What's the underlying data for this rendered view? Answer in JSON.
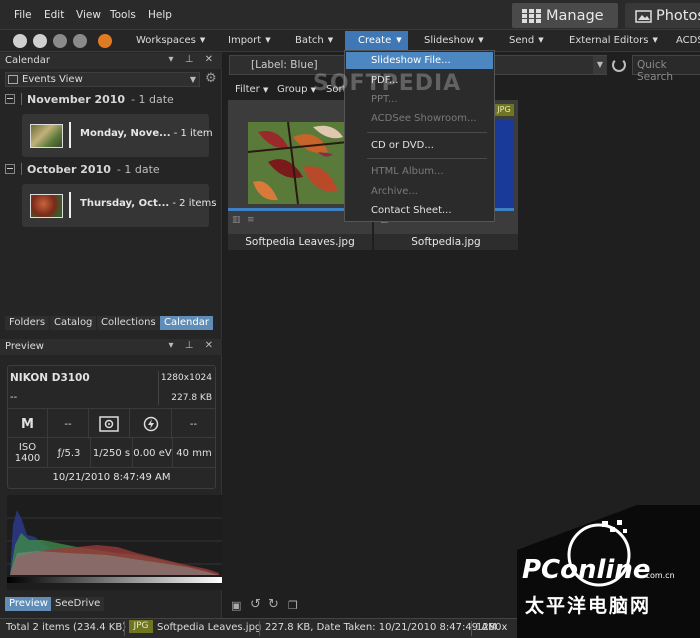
{
  "menu": {
    "items": [
      "File",
      "Edit",
      "View",
      "Tools",
      "Help"
    ],
    "modes": [
      "Manage",
      "Photos"
    ]
  },
  "toolbar": {
    "workspaces": "Workspaces",
    "import": "Import",
    "batch": "Batch",
    "create": "Create",
    "slideshow": "Slideshow",
    "send": "Send",
    "external_editors": "External Editors",
    "acds": "ACDS"
  },
  "calendar_panel": {
    "title": "Calendar",
    "view": "Events View",
    "groups": [
      {
        "month": "November 2010",
        "count": "- 1 date",
        "card_day": "Monday, Nove...",
        "card_count": "- 1 item"
      },
      {
        "month": "October 2010",
        "count": "- 1 date",
        "card_day": "Thursday, Oct...",
        "card_count": "- 2 items"
      }
    ],
    "tabs": [
      "Folders",
      "Catalog",
      "Collections",
      "Calendar"
    ]
  },
  "preview_panel": {
    "title": "Preview",
    "camera": "NIKON D3100",
    "dims": "1280x1024",
    "size": "227.8 KB",
    "dash": "--",
    "mode": "M",
    "iso": "ISO 1400",
    "aperture": "ƒ/5.3",
    "shutter": "1/250 s",
    "ev": "0.00 eV",
    "focal": "40 mm",
    "datetime": "10/21/2010 8:47:49 AM",
    "tabs": [
      "Preview",
      "SeeDrive"
    ]
  },
  "browser": {
    "filter_label": "[Label: Blue]",
    "quick_search_placeholder": "Quick Search",
    "subfilters": [
      "Filter",
      "Group",
      "Sort"
    ],
    "thumbnails": [
      {
        "name": "Softpedia Leaves.jpg"
      },
      {
        "name": "Softpedia.jpg",
        "badge": "JPG"
      }
    ]
  },
  "create_menu": {
    "items": [
      {
        "label": "Slideshow File...",
        "enabled": true
      },
      {
        "label": "PDF...",
        "enabled": true
      },
      {
        "label": "PPT...",
        "enabled": false
      },
      {
        "label": "ACDSee Showroom...",
        "enabled": false
      },
      {
        "label": "CD or DVD...",
        "enabled": true
      },
      {
        "label": "HTML Album...",
        "enabled": false
      },
      {
        "label": "Archive...",
        "enabled": false
      },
      {
        "label": "Contact Sheet...",
        "enabled": true
      }
    ]
  },
  "status": {
    "total": "Total 2 items  (234.4 KB)",
    "type": "JPG",
    "filename": "Softpedia Leaves.jpg",
    "details": "227.8 KB, Date Taken: 10/21/2010 8:47:49 AM",
    "dims": "1280x"
  },
  "watermarks": {
    "softpedia": "SOFTPEDIA",
    "pconline": "PConline",
    "pconline_domain": ".com.cn",
    "chinese": "太平洋电脑网"
  },
  "colors": {
    "accent": "#3f78b5",
    "highlight": "#4d87c2",
    "jpg_badge": "#6f7520"
  }
}
